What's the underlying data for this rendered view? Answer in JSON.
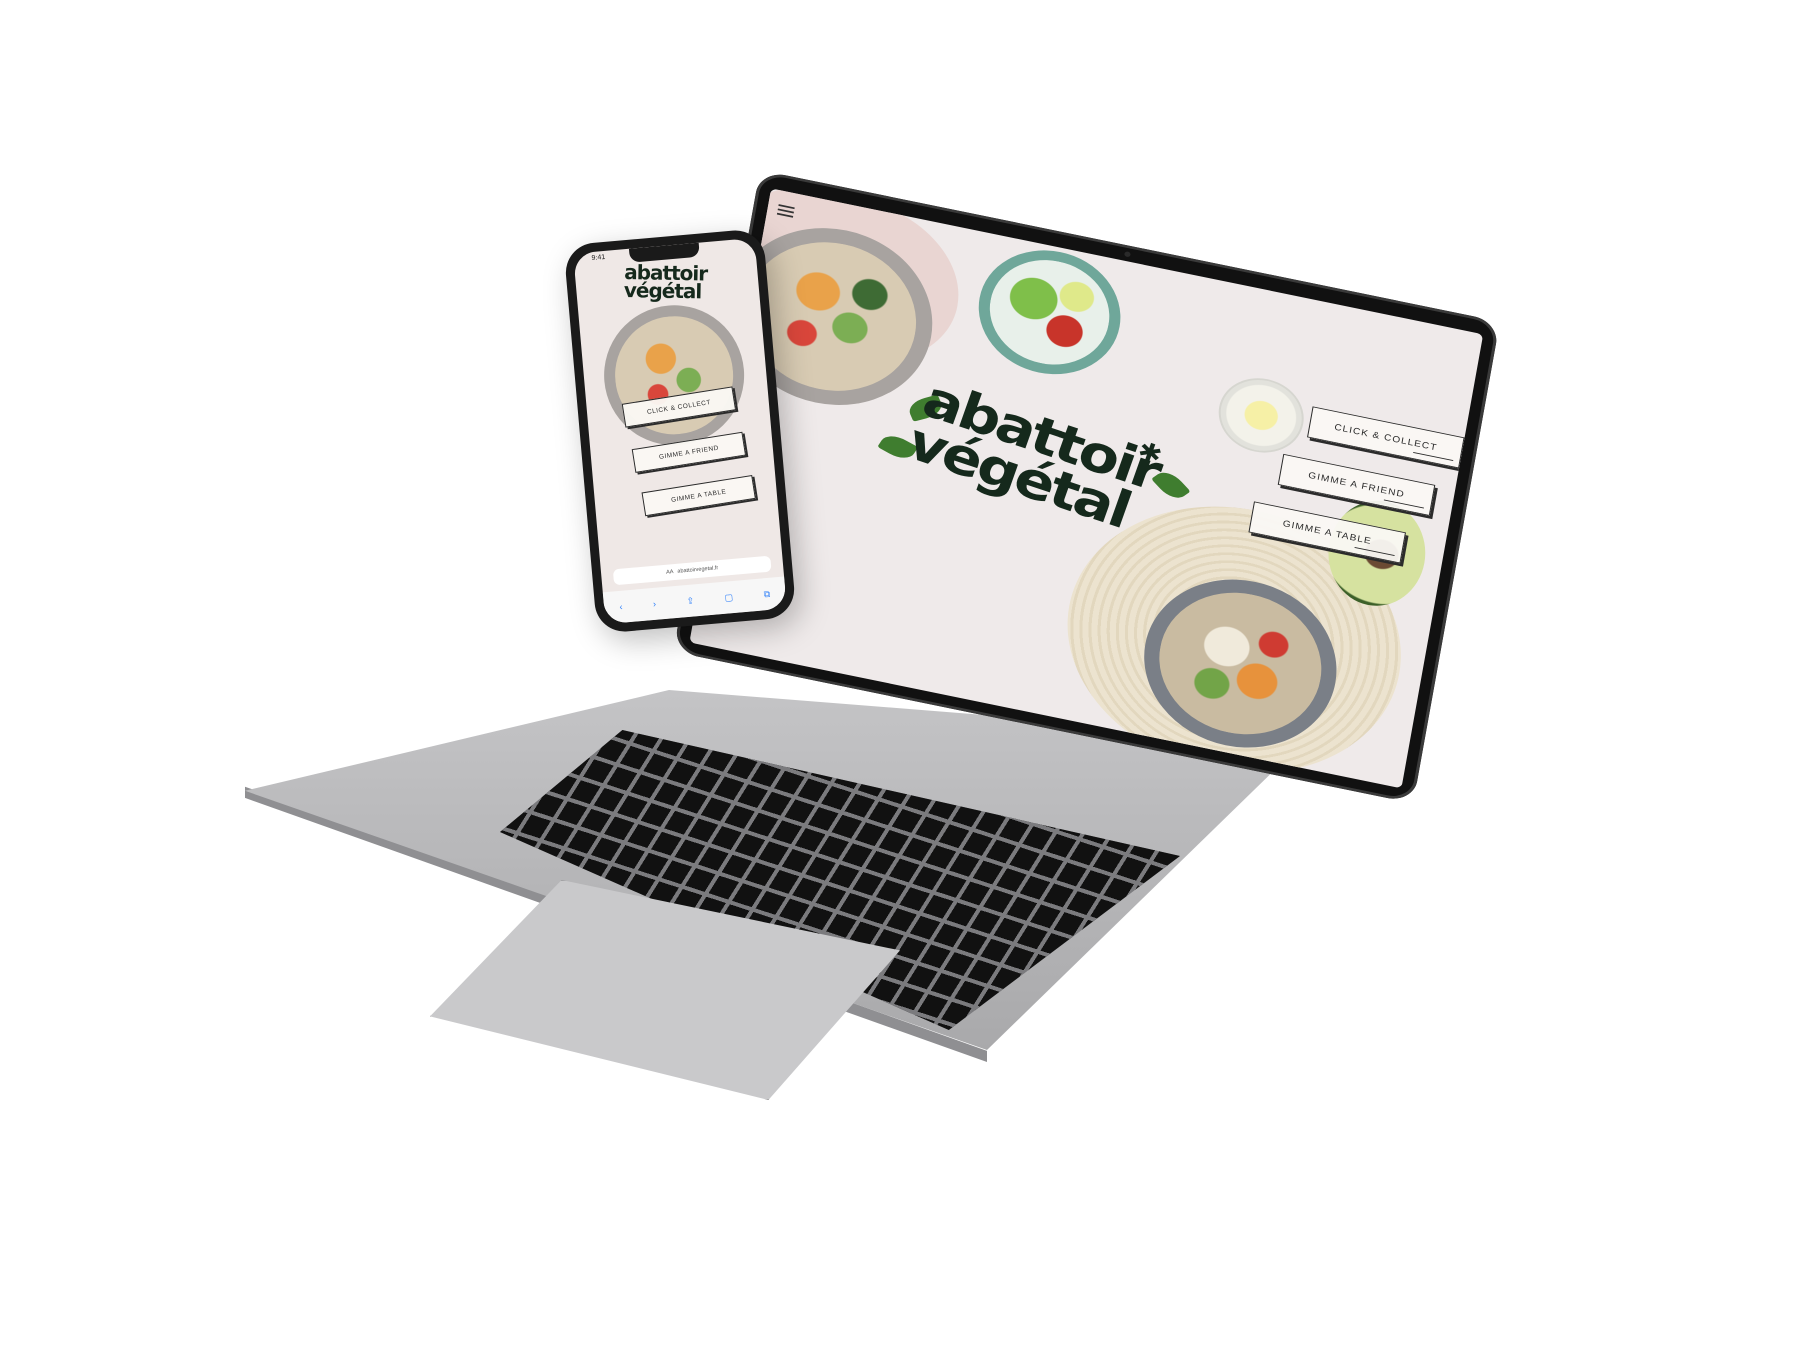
{
  "site": {
    "brand_line1": "abattoir",
    "brand_line2": "végétal",
    "brand_star": "✱",
    "ctas": [
      {
        "label": "CLICK & COLLECT"
      },
      {
        "label": "GIMME A FRIEND"
      },
      {
        "label": "GIMME A TABLE"
      }
    ]
  },
  "phone": {
    "status_time": "9:41",
    "url_text": "abattoirvegetal.fr",
    "url_prefix": "AA",
    "toolbar": {
      "back_icon": "‹",
      "forward_icon": "›",
      "share_icon": "⇪",
      "bookmarks_icon": "▢",
      "tabs_icon": "⧉"
    }
  },
  "colors": {
    "brand_green": "#15291c",
    "page_background": "#efeaea",
    "button_border": "#2b2b2b"
  }
}
